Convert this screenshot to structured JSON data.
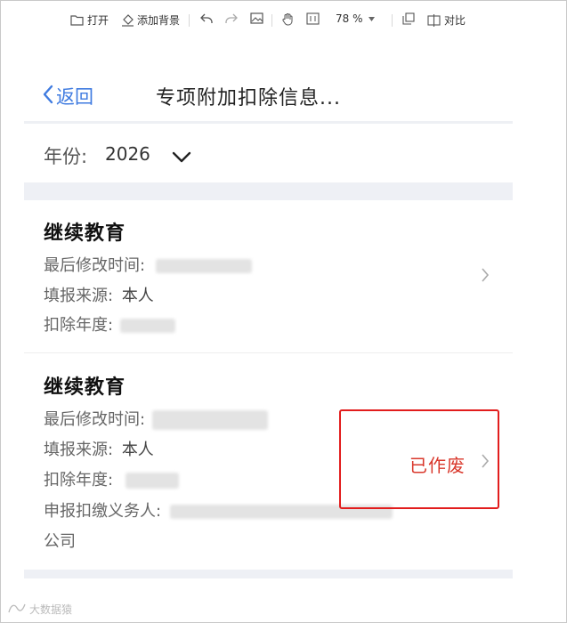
{
  "toolbar": {
    "open_label": "打开",
    "add_bg_label": "添加背景",
    "zoom": "78 %",
    "compare_label": "对比"
  },
  "nav": {
    "back_label": "返回",
    "title": "专项附加扣除信息..."
  },
  "year": {
    "label": "年份:",
    "value": "2026"
  },
  "cards": [
    {
      "title": "继续教育",
      "modified_label": "最后修改时间:",
      "source_label": "填报来源:",
      "source_value": "本人",
      "deduct_year_label": "扣除年度:"
    },
    {
      "title": "继续教育",
      "modified_label": "最后修改时间:",
      "source_label": "填报来源:",
      "source_value": "本人",
      "deduct_year_label": "扣除年度:",
      "withholder_label": "申报扣缴义务人:",
      "withholder_tail": "公司",
      "status": "已作废"
    }
  ],
  "colors": {
    "accent": "#3f7be0",
    "status_red": "#d9382c",
    "highlight_box": "#e21d1d",
    "band": "#eef0f5"
  },
  "watermark": "大数据猿"
}
